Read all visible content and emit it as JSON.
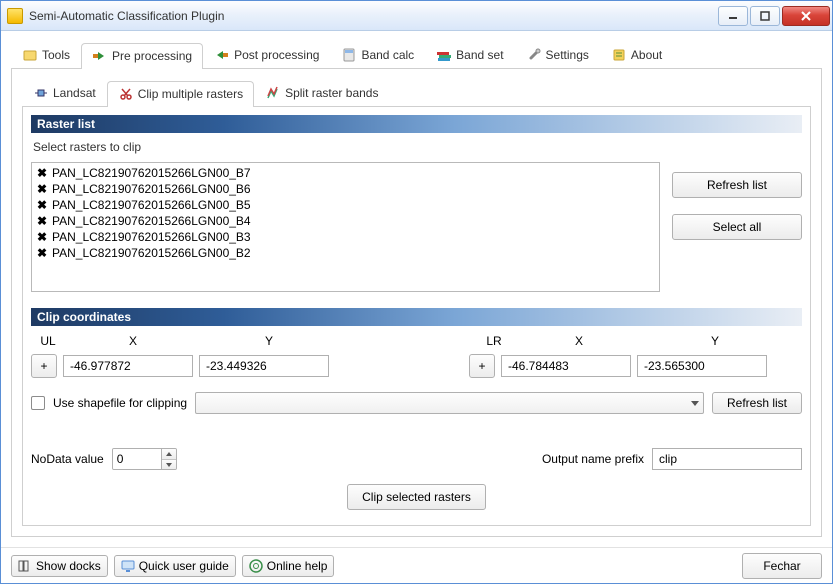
{
  "window": {
    "title": "Semi-Automatic Classification Plugin"
  },
  "tabs": {
    "tools": "Tools",
    "preprocessing": "Pre processing",
    "postprocessing": "Post processing",
    "bandcalc": "Band calc",
    "bandset": "Band set",
    "settings": "Settings",
    "about": "About"
  },
  "subtabs": {
    "landsat": "Landsat",
    "clip": "Clip multiple rasters",
    "split": "Split raster bands"
  },
  "group": {
    "raster_list": "Raster list",
    "select_text": "Select rasters to clip",
    "clip_coords": "Clip coordinates"
  },
  "rasters": [
    "PAN_LC82190762015266LGN00_B7",
    "PAN_LC82190762015266LGN00_B6",
    "PAN_LC82190762015266LGN00_B5",
    "PAN_LC82190762015266LGN00_B4",
    "PAN_LC82190762015266LGN00_B3",
    "PAN_LC82190762015266LGN00_B2"
  ],
  "buttons": {
    "refresh_list": "Refresh list",
    "select_all": "Select all",
    "clip_selected": "Clip selected rasters",
    "show_docks": "Show docks",
    "quick_guide": "Quick user guide",
    "online_help": "Online help",
    "close": "Fechar",
    "plus": "+"
  },
  "coords": {
    "ul_label": "UL",
    "lr_label": "LR",
    "x_label": "X",
    "y_label": "Y",
    "ul_x": "-46.977872",
    "ul_y": "-23.449326",
    "lr_x": "-46.784483",
    "lr_y": "-23.565300"
  },
  "shapefile": {
    "label": "Use shapefile for clipping"
  },
  "nodata": {
    "label": "NoData value",
    "value": "0"
  },
  "output": {
    "label": "Output name prefix",
    "value": "clip"
  }
}
